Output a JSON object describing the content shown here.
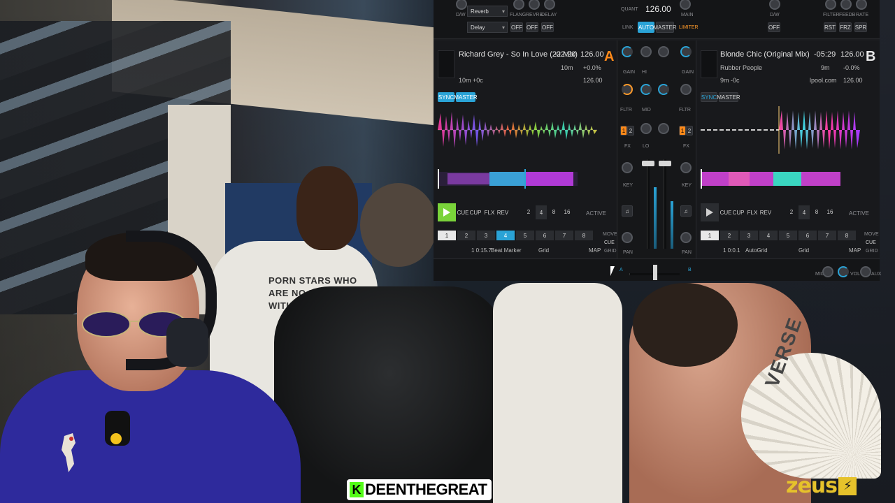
{
  "dj": {
    "top": {
      "deck_a_fx": {
        "dw_label": "D/W",
        "fx1": "Reverb",
        "fx2": "Delay",
        "flang": "FLANG",
        "revrb": "REVRB",
        "delay": "DELAY",
        "off": "OFF"
      },
      "quant_label": "QUANT",
      "bpm": "126.00",
      "link": "LINK",
      "auto": "AUTO",
      "master": "MASTER",
      "limiter": "LIMITER",
      "main": "MAIN",
      "deck_b_fx": {
        "dw_label": "D/W",
        "off": "OFF",
        "filter": "FILTER",
        "feedb": "FEEDB",
        "rate": "RATE",
        "rst": "RST",
        "frz": "FRZ",
        "spr": "SPR"
      }
    },
    "deck_a": {
      "letter": "A",
      "title": "Richard Grey - So In Love (22 Mix)",
      "remaining": "-02:20",
      "bpm": "126.00",
      "total": "10m",
      "pitch": "+0.0%",
      "key_info": "10m +0c",
      "orig_bpm": "126.00",
      "sync": "SYNC",
      "master": "MASTER",
      "cue": "CUE",
      "cup": "CUP",
      "flx": "FLX",
      "rev": "REV",
      "loops": [
        "2",
        "4",
        "8",
        "16"
      ],
      "active": "ACTIVE",
      "pads": [
        "1",
        "2",
        "3",
        "4",
        "5",
        "6",
        "7",
        "8"
      ],
      "marker_pos": "1 0:15.7",
      "marker_label": "Beat Marker",
      "grid": "Grid",
      "map": "MAP",
      "move": "MOVE",
      "cue_side": "CUE",
      "grid_side": "GRID"
    },
    "deck_b": {
      "letter": "B",
      "title": "Blonde Chic (Original Mix)",
      "artist": "Rubber People",
      "remaining": "-05:29",
      "bpm": "126.00",
      "total": "9m",
      "pitch": "-0.0%",
      "key_info": "9m -0c",
      "source": "lpool.com",
      "orig_bpm": "126.00",
      "sync": "SYNC",
      "master": "MASTER",
      "cue": "CUE",
      "cup": "CUP",
      "flx": "FLX",
      "rev": "REV",
      "loops": [
        "2",
        "4",
        "8",
        "16"
      ],
      "active": "ACTIVE",
      "pads": [
        "1",
        "2",
        "3",
        "4",
        "5",
        "6",
        "7",
        "8"
      ],
      "marker_pos": "1 0:0.1",
      "marker_label": "AutoGrid",
      "grid": "Grid",
      "map": "MAP",
      "move": "MOVE",
      "cue_side": "CUE",
      "grid_side": "GRID"
    },
    "mixer": {
      "gain": "GAIN",
      "hi": "HI",
      "mid": "MID",
      "lo": "LO",
      "fltr": "FLTR",
      "fx": "FX",
      "key": "KEY",
      "pan": "PAN",
      "fx1": "1",
      "fx2": "2"
    },
    "bottom": {
      "a": "A",
      "b": "B",
      "mic": "MIC",
      "vol": "VOL",
      "aux": "AUX"
    }
  },
  "video": {
    "shirt_text": "PORN STARS WHO ARE NO LONGER WITH",
    "fan_text": "VERSE"
  },
  "overlay": {
    "handle_badge": "K",
    "handle": "DEENTHEGREAT",
    "brand": "zeus",
    "brand_icon": "⚡"
  }
}
